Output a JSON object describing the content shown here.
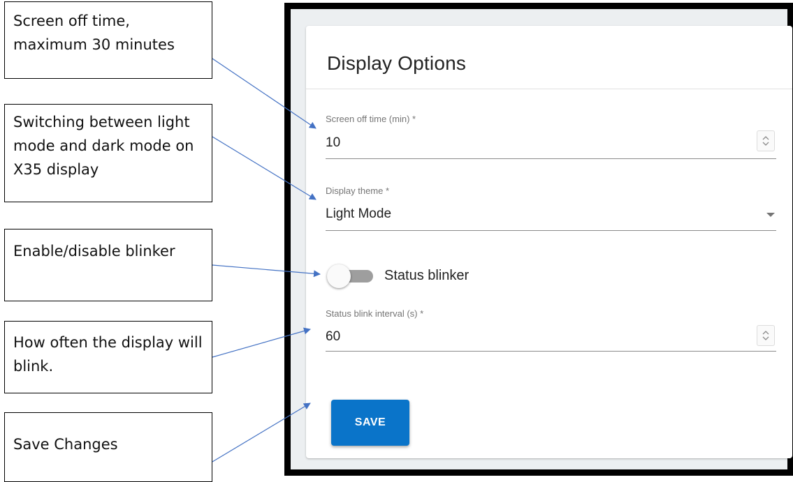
{
  "callouts": {
    "screen_off": "Screen off time, maximum 30 minutes",
    "theme": "Switching between light mode and dark mode on X35 display",
    "blinker": "Enable/disable blinker",
    "interval": "How often the display will blink.",
    "save": "Save Changes"
  },
  "card": {
    "title": "Display Options",
    "screen_off": {
      "label": "Screen off time (min) *",
      "value": "10"
    },
    "theme": {
      "label": "Display theme *",
      "value": "Light Mode"
    },
    "blinker": {
      "label": "Status blinker",
      "enabled": false
    },
    "interval": {
      "label": "Status blink interval (s) *",
      "value": "60"
    },
    "save_label": "SAVE"
  },
  "colors": {
    "accent": "#0a74c9",
    "arrow": "#4472c4",
    "toggle_track_off": "#9e9e9e"
  },
  "icons": {
    "spinner": "up-down-chevron-icon",
    "dropdown": "caret-down-icon"
  }
}
